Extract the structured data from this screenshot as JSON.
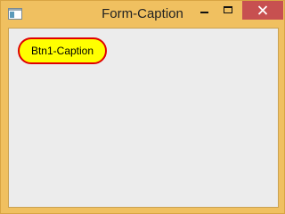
{
  "window": {
    "title": "Form-Caption",
    "frame_color": "#f0c060",
    "client_color": "#ececec",
    "icons": {
      "app": "window-app-icon",
      "minimize": "minimize-icon",
      "maximize": "maximize-icon",
      "close": "close-icon"
    },
    "close_button_color": "#c75050"
  },
  "form": {
    "button1": {
      "label": "Btn1-Caption",
      "fill_color": "#ffff00",
      "border_color": "#e00000"
    }
  }
}
